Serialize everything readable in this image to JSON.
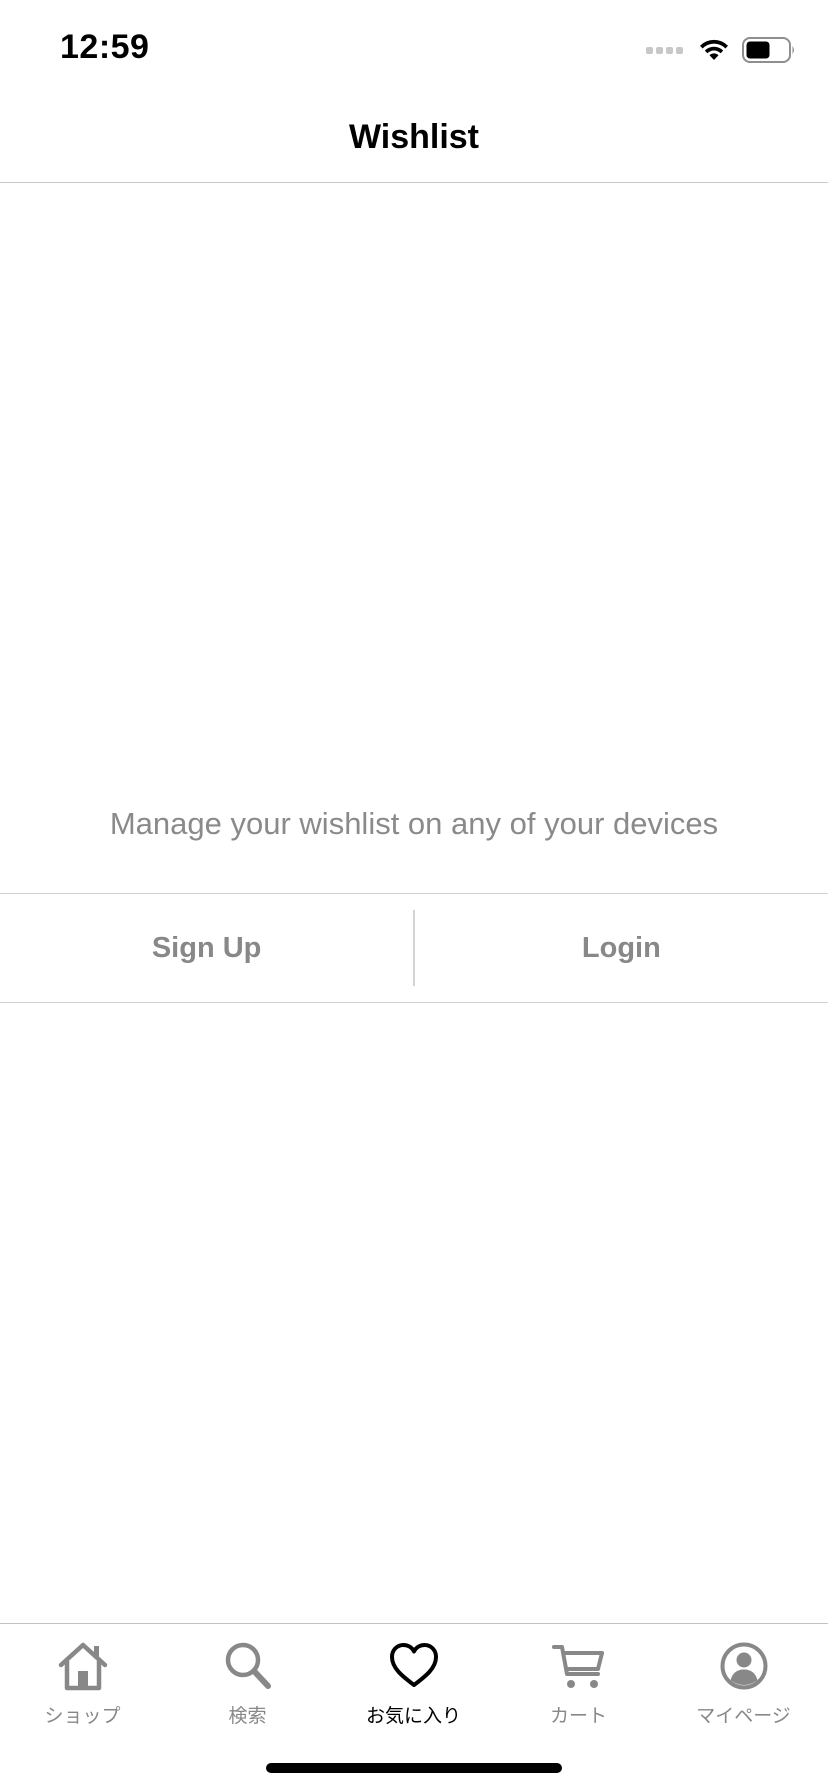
{
  "status_bar": {
    "time": "12:59"
  },
  "nav": {
    "title": "Wishlist"
  },
  "wishlist": {
    "message": "Manage your wishlist on any of your devices"
  },
  "auth": {
    "sign_up_label": "Sign Up",
    "login_label": "Login"
  },
  "tab_bar": {
    "items": [
      {
        "label": "ショップ",
        "icon": "home-icon",
        "active": false
      },
      {
        "label": "検索",
        "icon": "search-icon",
        "active": false
      },
      {
        "label": "お気に入り",
        "icon": "heart-icon",
        "active": true
      },
      {
        "label": "カート",
        "icon": "cart-icon",
        "active": false
      },
      {
        "label": "マイページ",
        "icon": "profile-icon",
        "active": false
      }
    ]
  },
  "colors": {
    "inactive_gray": "#888888",
    "active": "#000000",
    "divider": "#d3d3d3",
    "message_gray": "#8a8a8a"
  }
}
